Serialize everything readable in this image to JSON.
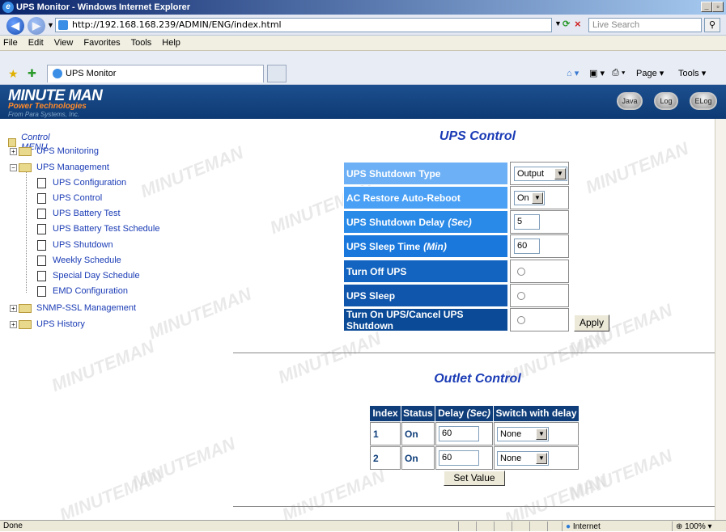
{
  "window": {
    "title": "UPS Monitor - Windows Internet Explorer",
    "min_label": "_",
    "max_label": "▫",
    "close_label": "×"
  },
  "address_bar": {
    "url": "http://192.168.168.239/ADMIN/ENG/index.html",
    "search_placeholder": "Live Search"
  },
  "menu": [
    "File",
    "Edit",
    "View",
    "Favorites",
    "Tools",
    "Help"
  ],
  "tab": {
    "label": "UPS Monitor"
  },
  "command_bar": {
    "page_label": "Page ▾",
    "tools_label": "Tools ▾"
  },
  "header": {
    "logo_main": "MINUTE MAN",
    "logo_sub": "Power Technologies",
    "logo_sub2": "From Para Systems, Inc.",
    "buttons": {
      "java": "Java",
      "log": "Log",
      "elog": "ELog"
    }
  },
  "sidebar": {
    "root": "Control MENU",
    "items": [
      {
        "label": "UPS Monitoring",
        "type": "folder"
      },
      {
        "label": "UPS Management",
        "type": "folder-open"
      },
      {
        "label": "UPS Configuration",
        "type": "doc"
      },
      {
        "label": "UPS Control",
        "type": "doc"
      },
      {
        "label": "UPS Battery Test",
        "type": "doc"
      },
      {
        "label": "UPS Battery Test Schedule",
        "type": "doc"
      },
      {
        "label": "UPS Shutdown",
        "type": "doc"
      },
      {
        "label": "Weekly Schedule",
        "type": "doc"
      },
      {
        "label": "Special Day Schedule",
        "type": "doc"
      },
      {
        "label": "EMD Configuration",
        "type": "doc"
      },
      {
        "label": "SNMP-SSL Management",
        "type": "folder"
      },
      {
        "label": "UPS History",
        "type": "folder"
      }
    ]
  },
  "ups_control": {
    "title": "UPS Control",
    "rows": [
      {
        "label": "UPS Shutdown Type",
        "value": "Output",
        "control": "select"
      },
      {
        "label": "AC Restore Auto-Reboot",
        "value": "On",
        "control": "select"
      },
      {
        "label": "UPS Shutdown Delay",
        "unit": "(Sec)",
        "value": "5",
        "control": "input"
      },
      {
        "label": "UPS Sleep Time",
        "unit": "(Min)",
        "value": "60",
        "control": "input"
      },
      {
        "label": "Turn Off UPS",
        "control": "radio"
      },
      {
        "label": "UPS Sleep",
        "control": "radio"
      },
      {
        "label": "Turn On UPS/Cancel UPS Shutdown",
        "control": "radio"
      }
    ],
    "apply_label": "Apply",
    "colors": [
      "#6db0f5",
      "#4aa0f5",
      "#2a8ae8",
      "#1a78dc",
      "#1264c0",
      "#0f56ac",
      "#0a4a96"
    ]
  },
  "outlet_control": {
    "title": "Outlet Control",
    "headers": [
      "Index",
      "Status",
      "Delay",
      "(Sec)",
      "Switch with delay"
    ],
    "rows": [
      {
        "index": "1",
        "status": "On",
        "delay": "60",
        "switch": "None"
      },
      {
        "index": "2",
        "status": "On",
        "delay": "60",
        "switch": "None"
      }
    ],
    "set_label": "Set Value"
  },
  "status_bar": {
    "left": "Done",
    "zone": "Internet",
    "zoom": "100%"
  },
  "watermark": "MINUTEMAN"
}
